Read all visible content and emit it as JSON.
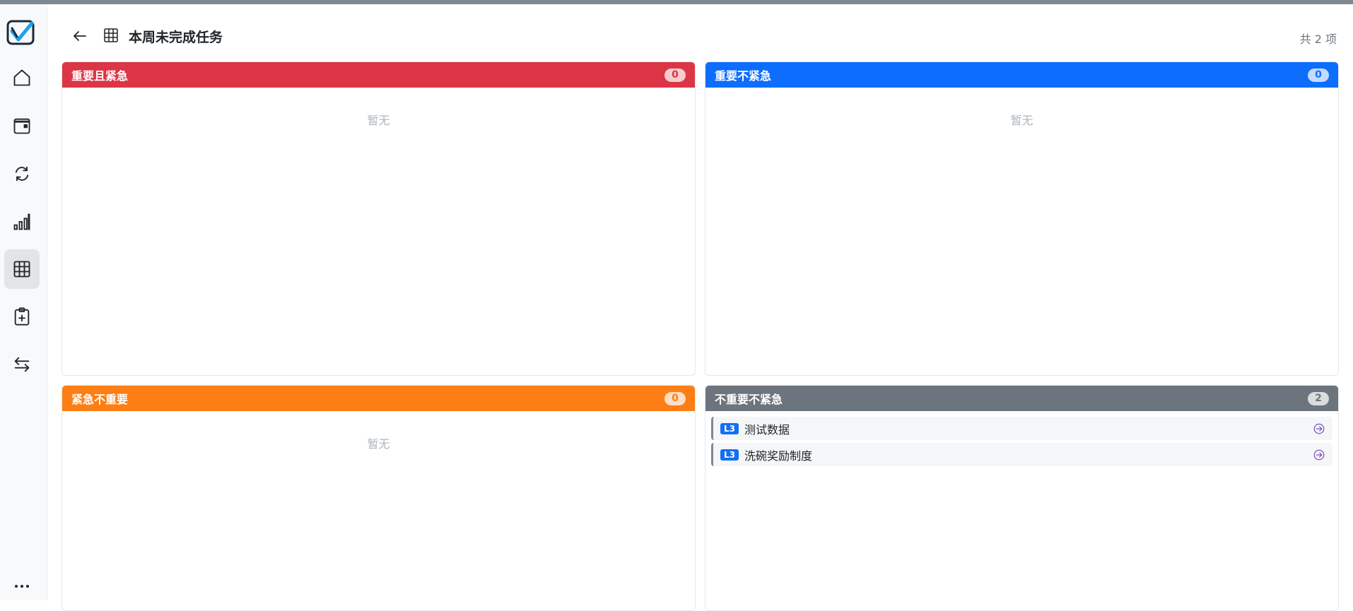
{
  "header": {
    "title": "本周未完成任务",
    "total": "共 2 项"
  },
  "sidebar": {
    "items": [
      {
        "icon": "home-icon"
      },
      {
        "icon": "calendar-icon"
      },
      {
        "icon": "refresh-icon"
      },
      {
        "icon": "chart-icon"
      },
      {
        "icon": "grid-icon",
        "active": true
      },
      {
        "icon": "clipboard-add-icon"
      },
      {
        "icon": "swap-icon"
      }
    ],
    "more": "…"
  },
  "quadrants": [
    {
      "title": "重要且紧急",
      "count": "0",
      "color": "#dc3545",
      "empty": "暂无"
    },
    {
      "title": "重要不紧急",
      "count": "0",
      "color": "#0d6efd",
      "empty": "暂无"
    },
    {
      "title": "紧急不重要",
      "count": "0",
      "color": "#fd7e14",
      "empty": "暂无"
    },
    {
      "title": "不重要不紧急",
      "count": "2",
      "color": "#6c757d",
      "tasks": [
        {
          "level": "L3",
          "title": "测试数据"
        },
        {
          "level": "L3",
          "title": "洗碗奖励制度"
        }
      ]
    }
  ]
}
